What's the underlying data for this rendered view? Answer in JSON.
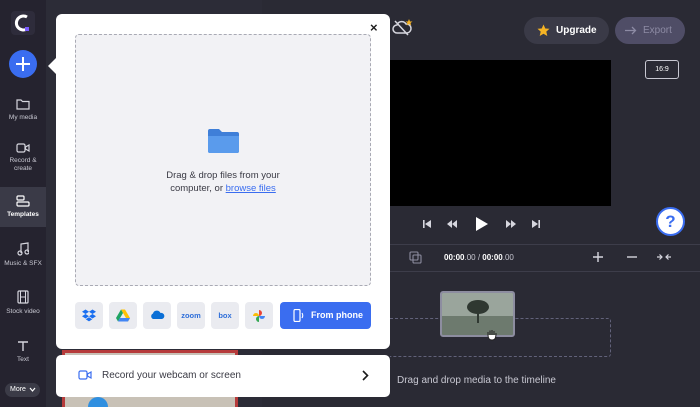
{
  "rail": {
    "items": [
      {
        "label": "My media",
        "icon": "folder-icon"
      },
      {
        "label": "Record & create",
        "label_line1": "Record &",
        "label_line2": "create",
        "icon": "video-camera-icon"
      },
      {
        "label": "Templates",
        "icon": "templates-icon",
        "active": true
      },
      {
        "label": "Music & SFX",
        "icon": "music-note-icon"
      },
      {
        "label": "Stock video",
        "icon": "film-icon"
      },
      {
        "label": "Text",
        "icon": "text-icon"
      }
    ],
    "more_label": "More"
  },
  "header": {
    "upgrade_label": "Upgrade",
    "export_label": "Export"
  },
  "preview": {
    "aspect_ratio": "16:9"
  },
  "timeline": {
    "current_time": "00:00",
    "current_frac": ".00",
    "total_time": "00:00",
    "total_frac": ".00",
    "separator": " / ",
    "drop_hint": "Drag and drop media to the timeline"
  },
  "import_popup": {
    "drop_line1": "Drag & drop files from your",
    "drop_line2_prefix": "computer, or ",
    "browse_link": "browse files",
    "sources": [
      "Dropbox",
      "Google Drive",
      "OneDrive",
      "zoom",
      "box",
      "Google Photos"
    ],
    "zoom_label": "zoom",
    "box_label": "box",
    "from_phone_label": "From phone",
    "close_symbol": "×"
  },
  "record": {
    "label": "Record your webcam or screen"
  },
  "help_symbol": "?",
  "colors": {
    "accent": "#3a6df0",
    "rail_bg": "#25232f",
    "app_bg": "#2a2a34",
    "upgrade_star": "#f5b324"
  }
}
